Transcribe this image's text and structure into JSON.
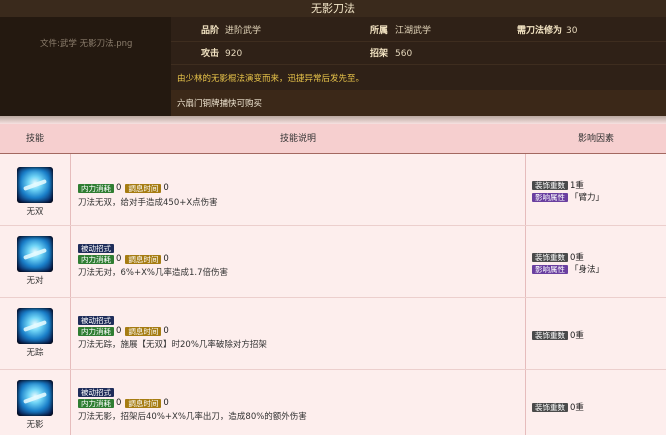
{
  "panel": {
    "title": "无影刀法",
    "file_label": "文件:武学 无影刀法.png",
    "rows": [
      [
        {
          "key": "品阶",
          "value": "进阶武学"
        },
        {
          "key": "所属",
          "value": "江湖武学"
        },
        {
          "key": "需刀法修为",
          "value": "30"
        }
      ],
      [
        {
          "key": "攻击",
          "value": "920"
        },
        {
          "key": "招架",
          "value": "560"
        }
      ]
    ],
    "description": "由少林的无影棍法演变而来，迅捷异常后发先至。",
    "buy_text": "六扇门铜牌捕快可购买"
  },
  "table": {
    "headers": [
      "技能",
      "技能说明",
      "影响因素"
    ],
    "rows": [
      {
        "name": "无双",
        "tags_line1": [],
        "tags_line2": [
          {
            "label": "内力消耗",
            "value": "0"
          },
          {
            "label": "調息时间",
            "value": "0"
          }
        ],
        "description": "刀法无双，给对手造成450+X点伤害",
        "factors": [
          {
            "label": "装饰重数",
            "value": "1重"
          },
          {
            "label": "影响属性",
            "value": "「臂力」"
          }
        ]
      },
      {
        "name": "无对",
        "tags_line1": [
          {
            "label": "被动招式"
          }
        ],
        "tags_line2": [
          {
            "label": "内力消耗",
            "value": "0"
          },
          {
            "label": "調息时间",
            "value": "0"
          }
        ],
        "description": "刀法无对，6%+X%几率造成1.7倍伤害",
        "factors": [
          {
            "label": "装饰重数",
            "value": "0重"
          },
          {
            "label": "影响属性",
            "value": "「身法」"
          }
        ]
      },
      {
        "name": "无踪",
        "tags_line1": [
          {
            "label": "被动招式"
          }
        ],
        "tags_line2": [
          {
            "label": "内力消耗",
            "value": "0"
          },
          {
            "label": "調息时间",
            "value": "0"
          }
        ],
        "description": "刀法无踪，施展【无双】时20%几率破除对方招架",
        "factors": [
          {
            "label": "装饰重数",
            "value": "0重"
          }
        ]
      },
      {
        "name": "无影",
        "tags_line1": [
          {
            "label": "被动招式"
          }
        ],
        "tags_line2": [
          {
            "label": "内力消耗",
            "value": "0"
          },
          {
            "label": "調息时间",
            "value": "0"
          }
        ],
        "description": "刀法无影，招架后40%+X%几率出刀，造成80%的额外伤害",
        "factors": [
          {
            "label": "装饰重数",
            "value": "0重"
          }
        ]
      }
    ]
  }
}
